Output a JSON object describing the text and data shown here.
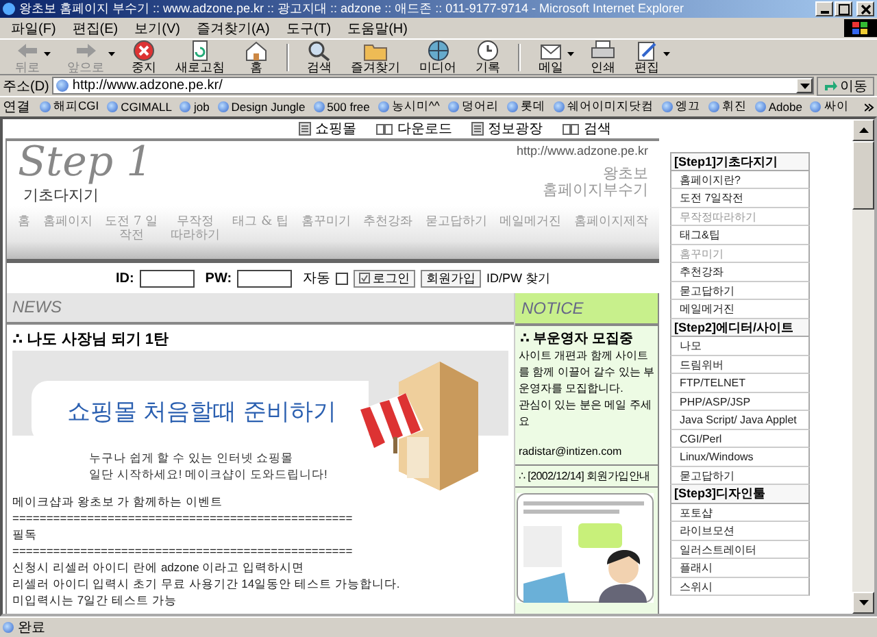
{
  "window": {
    "title": "왕초보 홈페이지 부수기 :: www.adzone.pe.kr :: 광고지대 :: adzone :: 애드존 :: 011-9177-9714 - Microsoft Internet Explorer"
  },
  "menu": [
    "파일(F)",
    "편집(E)",
    "보기(V)",
    "즐겨찾기(A)",
    "도구(T)",
    "도움말(H)"
  ],
  "toolbar": [
    [
      {
        "label": "뒤로",
        "disabled": true,
        "dropdown": true
      },
      {
        "label": "앞으로",
        "disabled": true,
        "dropdown": true
      },
      {
        "label": "중지",
        "disabled": false,
        "dropdown": false
      },
      {
        "label": "새로고침",
        "disabled": false,
        "dropdown": false
      },
      {
        "label": "홈",
        "disabled": false,
        "dropdown": false
      }
    ],
    [
      {
        "label": "검색",
        "disabled": false,
        "dropdown": false
      },
      {
        "label": "즐겨찾기",
        "disabled": false,
        "dropdown": false
      },
      {
        "label": "미디어",
        "disabled": false,
        "dropdown": false
      },
      {
        "label": "기록",
        "disabled": false,
        "dropdown": false
      }
    ],
    [
      {
        "label": "메일",
        "disabled": false,
        "dropdown": true
      },
      {
        "label": "인쇄",
        "disabled": false,
        "dropdown": false
      },
      {
        "label": "편집",
        "disabled": false,
        "dropdown": true
      }
    ]
  ],
  "address": {
    "label": "주소(D)",
    "value": "http://www.adzone.pe.kr/",
    "go": "이동"
  },
  "links": {
    "label": "연결",
    "items": [
      "해피CGI",
      "CGIMALL",
      "job",
      "Design Jungle",
      "500 free",
      "농시미^^",
      "덩어리",
      "롯데",
      "쉐어이미지닷컴",
      "엥끄",
      "휘진",
      "Adobe",
      "싸이"
    ]
  },
  "top_nav": [
    "쇼핑몰",
    "다운로드",
    "정보광장",
    "검색"
  ],
  "header": {
    "logo": "Step 1",
    "subtitle": "기초다지기",
    "url": "http://www.adzone.pe.kr",
    "title": [
      "왕초보",
      "홈페이지부수기"
    ]
  },
  "nav": [
    [
      "홈"
    ],
    [
      "홈페이지"
    ],
    [
      "도전 7 일",
      "작전"
    ],
    [
      "무작정",
      "따라하기"
    ],
    [
      "태그 & 팁"
    ],
    [
      "홈꾸미기"
    ],
    [
      "추천강좌"
    ],
    [
      "묻고답하기"
    ],
    [
      "메일메거진"
    ],
    [
      "홈페이지제작"
    ]
  ],
  "login": {
    "id_label": "ID:",
    "pw_label": "PW:",
    "auto_label": "자동",
    "auto_checked": false,
    "buttons": [
      "로그인",
      "회원가입"
    ],
    "find": "ID/PW 찾기"
  },
  "news": {
    "heading": "NEWS",
    "title": "∴ 나도 사장님 되기 1탄",
    "banner": {
      "headline": "쇼핑몰 처음할때 준비하기",
      "lines": [
        "누구나 쉽게 할 수 있는 인터넷 쇼핑몰",
        "일단 시작하세요! 메이크샵이 도와드립니다!"
      ]
    },
    "body": [
      "메이크샵과 왕초보 가 함께하는 이벤트",
      "==================================================",
      "필독",
      "==================================================",
      "신청시 리셀러 아이디 란에 adzone 이라고 입력하시면",
      "리셀러 아이디 입력시 초기 무료 사용기간 14일동안 테스트 가능합니다.",
      "미입력시는 7일간 테스트 가능"
    ]
  },
  "notice": {
    "heading": "NOTICE",
    "title": "∴ 부운영자 모집중",
    "text": "사이트 개편과 함께 사이트를 함께 이끌어 갈수 있는 부운영자를 모집합니다.",
    "text2": "관심이 있는 분은 메일 주세요",
    "email": "radistar@intizen.com",
    "link": "∴ [2002/12/14] 회원가입안내"
  },
  "sidebar": [
    {
      "title": "[Step1]기초다지기",
      "items": [
        {
          "label": "홈페이지란?",
          "dimmed": false
        },
        {
          "label": "도전 7일작전",
          "dimmed": false
        },
        {
          "label": "무작정따라하기",
          "dimmed": true
        },
        {
          "label": "태그&팁",
          "dimmed": false
        },
        {
          "label": "홈꾸미기",
          "dimmed": true
        },
        {
          "label": "추천강좌",
          "dimmed": false
        },
        {
          "label": "묻고답하기",
          "dimmed": false
        },
        {
          "label": "메일메거진",
          "dimmed": false
        }
      ]
    },
    {
      "title": "[Step2]에디터/사이트",
      "items": [
        {
          "label": "나모",
          "dimmed": false
        },
        {
          "label": "드림위버",
          "dimmed": false
        },
        {
          "label": "FTP/TELNET",
          "dimmed": false
        },
        {
          "label": "PHP/ASP/JSP",
          "dimmed": false
        },
        {
          "label": "Java Script/ Java Applet",
          "dimmed": false
        },
        {
          "label": "CGI/Perl",
          "dimmed": false
        },
        {
          "label": "Linux/Windows",
          "dimmed": false
        },
        {
          "label": "묻고답하기",
          "dimmed": false
        }
      ]
    },
    {
      "title": "[Step3]디자인툴",
      "items": [
        {
          "label": "포토샵",
          "dimmed": false
        },
        {
          "label": "라이브모션",
          "dimmed": false
        },
        {
          "label": "일러스트레이터",
          "dimmed": false
        },
        {
          "label": "플래시",
          "dimmed": false
        },
        {
          "label": "스위시",
          "dimmed": false
        }
      ]
    }
  ],
  "status": "완료"
}
